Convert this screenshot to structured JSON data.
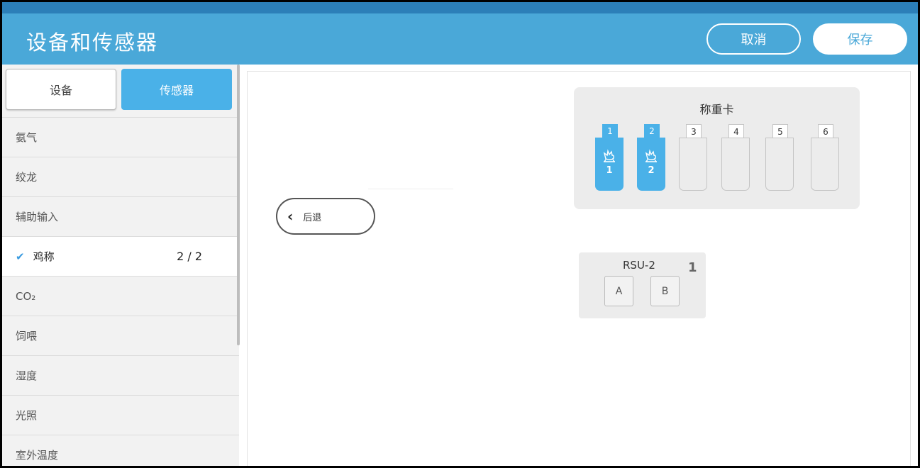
{
  "header": {
    "title": "设备和传感器",
    "cancel_label": "取消",
    "save_label": "保存"
  },
  "tabs": {
    "device": "设备",
    "sensor": "传感器"
  },
  "sensors": [
    {
      "label": "氨气",
      "count": "",
      "checked": false
    },
    {
      "label": "绞龙",
      "count": "",
      "checked": false
    },
    {
      "label": "辅助输入",
      "count": "",
      "checked": false
    },
    {
      "label": "鸡称",
      "count": "2 / 2",
      "checked": true
    },
    {
      "label": "CO₂",
      "count": "",
      "checked": false
    },
    {
      "label": "饲喂",
      "count": "",
      "checked": false
    },
    {
      "label": "湿度",
      "count": "",
      "checked": false
    },
    {
      "label": "光照",
      "count": "",
      "checked": false
    },
    {
      "label": "室外温度",
      "count": "",
      "checked": false
    }
  ],
  "check_mark": "✔",
  "back_label": "后退",
  "back_icon": "‹",
  "weigh_card": {
    "title": "称重卡",
    "slots": [
      {
        "label": "1",
        "assigned": "1"
      },
      {
        "label": "2",
        "assigned": "2"
      },
      {
        "label": "3",
        "assigned": ""
      },
      {
        "label": "4",
        "assigned": ""
      },
      {
        "label": "5",
        "assigned": ""
      },
      {
        "label": "6",
        "assigned": ""
      }
    ]
  },
  "rsu": {
    "name": "RSU-2",
    "number": "1",
    "ports": [
      "A",
      "B"
    ]
  },
  "colors": {
    "header": "#4aa8d8",
    "accent": "#4ab1e8",
    "check": "#3a9be0"
  },
  "icons": {
    "slot_assigned": "bird-scale-icon",
    "back": "chevron-left-icon"
  }
}
